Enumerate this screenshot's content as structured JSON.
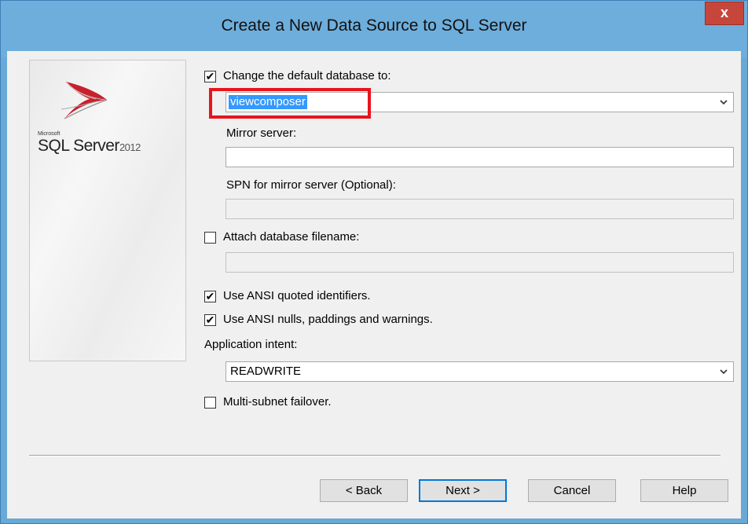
{
  "window": {
    "title": "Create a New Data Source to SQL Server",
    "close_label": "x"
  },
  "logo": {
    "brand": "Microsoft",
    "product": "SQL Server",
    "version": "2012"
  },
  "form": {
    "change_default_db": {
      "label": "Change the default database to:",
      "checked": true,
      "value": "viewcomposer"
    },
    "mirror_server": {
      "label": "Mirror server:",
      "value": ""
    },
    "spn_mirror": {
      "label": "SPN for mirror server (Optional):",
      "value": ""
    },
    "attach_db": {
      "label": "Attach database filename:",
      "checked": false,
      "value": ""
    },
    "ansi_quoted": {
      "label": "Use ANSI quoted identifiers.",
      "checked": true
    },
    "ansi_nulls": {
      "label": "Use ANSI nulls, paddings and warnings.",
      "checked": true
    },
    "app_intent": {
      "label": "Application intent:",
      "value": "READWRITE"
    },
    "multi_subnet": {
      "label": "Multi-subnet failover.",
      "checked": false
    }
  },
  "buttons": {
    "back": "< Back",
    "next": "Next >",
    "cancel": "Cancel",
    "help": "Help"
  },
  "check_glyph": "✔",
  "colors": {
    "titlebar": "#6eaedc",
    "close_button": "#c7463b",
    "selection": "#3399ff",
    "highlight_box": "#e8141c"
  }
}
